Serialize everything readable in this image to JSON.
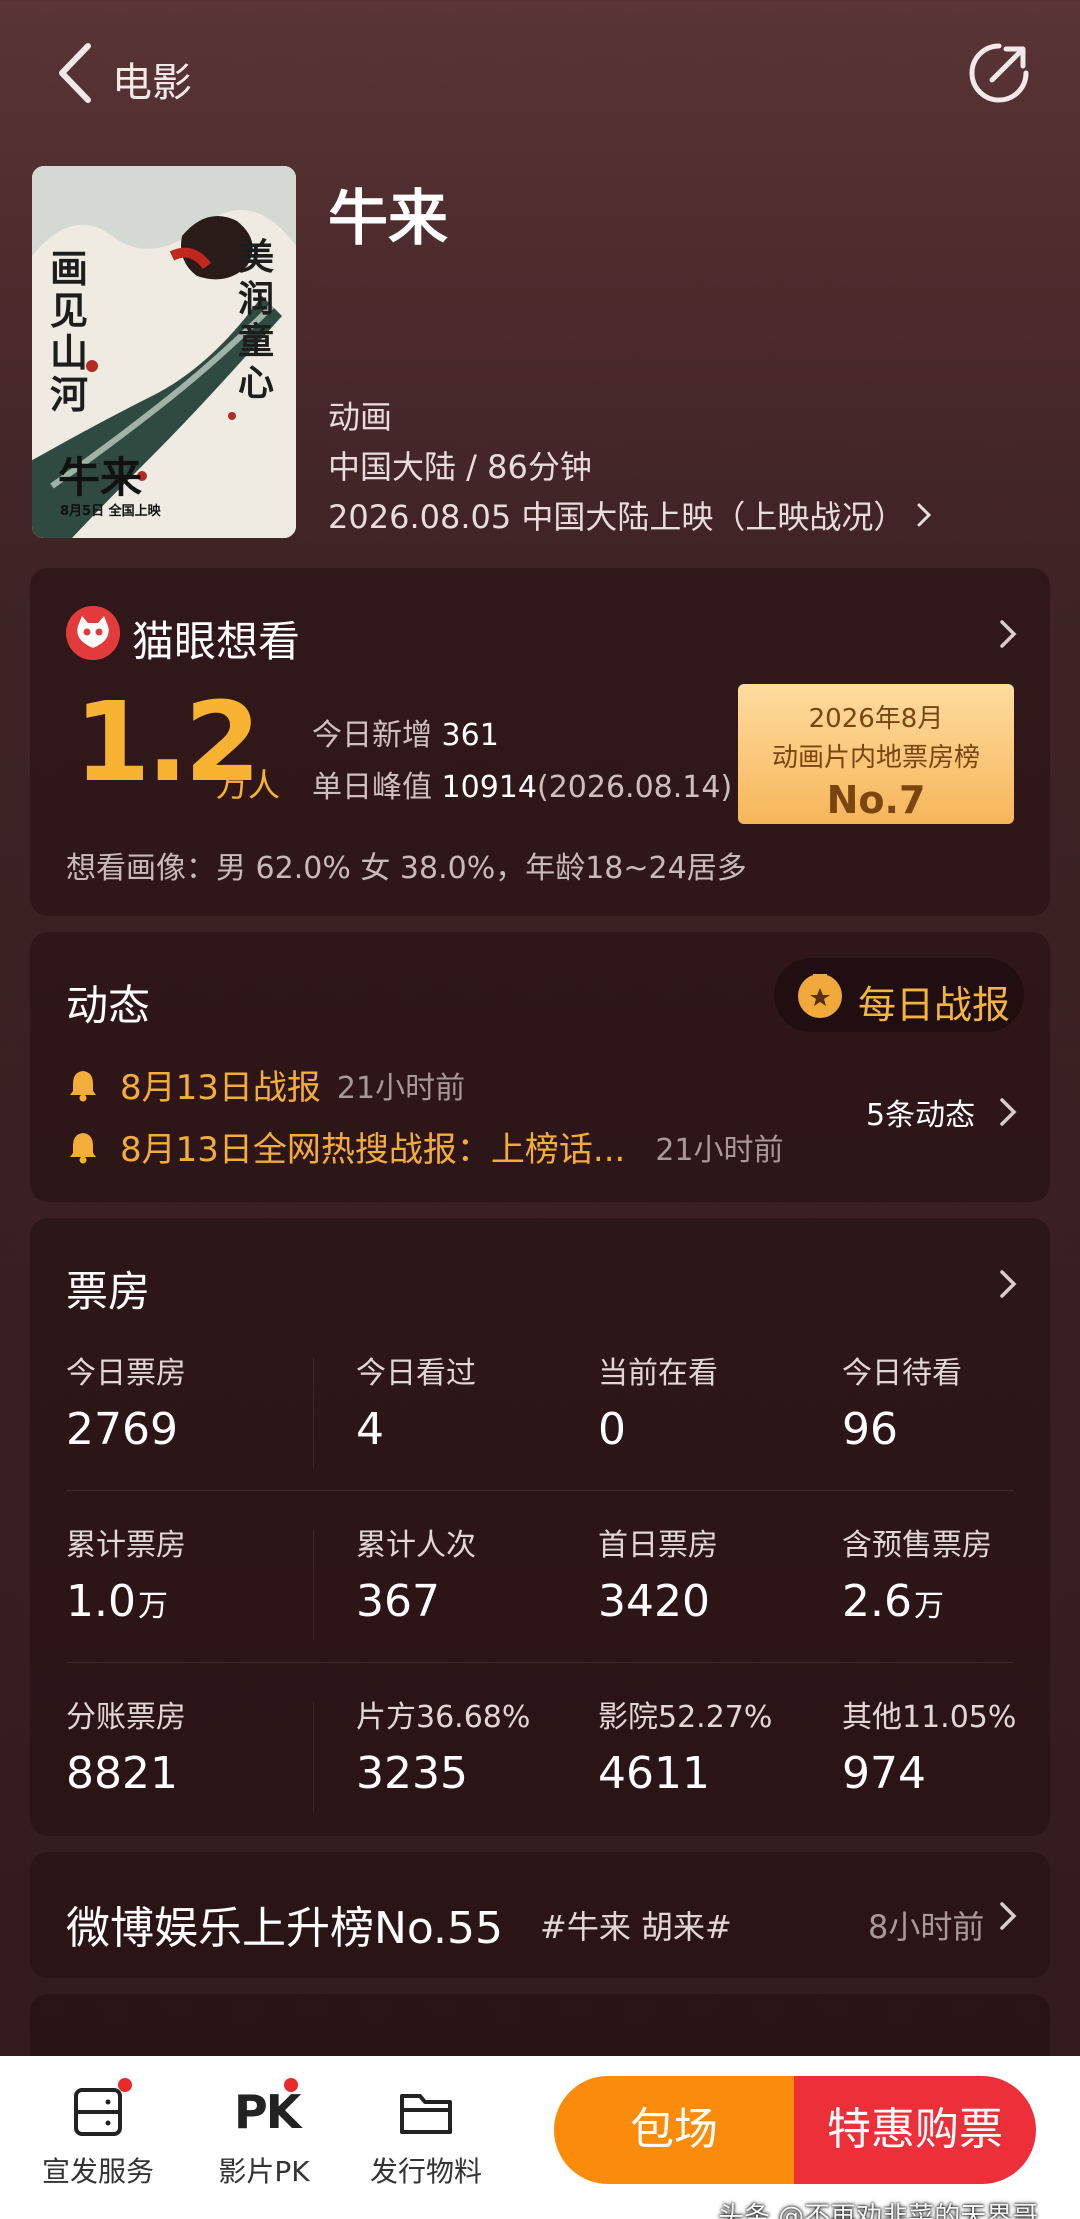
{
  "header": {
    "back_label": "电影",
    "icons": {
      "back": "chevron-left-icon",
      "share": "share-icon"
    }
  },
  "movie": {
    "title": "牛来",
    "genre": "动画",
    "region_duration": "中国大陆 / 86分钟",
    "release": "2026.08.05 中国大陆上映（上映战况）",
    "poster": {
      "left_vertical": "画见山河",
      "right_vertical": "美润童心",
      "name": "牛来",
      "date_line": "8月5日  全国上映"
    }
  },
  "want": {
    "title": "猫眼想看",
    "count": "1.2",
    "unit": "万人",
    "today_label": "今日新增",
    "today_value": "361",
    "peak_label": "单日峰值",
    "peak_value": "10914",
    "peak_date": "(2026.08.14)",
    "rank_line1": "2026年8月",
    "rank_line2": "动画片内地票房榜",
    "rank_no": "No.7",
    "portrait": "想看画像：男 62.0%  女 38.0%，年龄18~24居多"
  },
  "news": {
    "title": "动态",
    "daily_report": "每日战报",
    "items": [
      {
        "title": "8月13日战报",
        "time": "21小时前"
      },
      {
        "title": "8月13日全网热搜战报：上榜话...",
        "time": "21小时前"
      }
    ],
    "more": "5条动态"
  },
  "box_office": {
    "title": "票房",
    "rows": [
      [
        {
          "label": "今日票房",
          "value": "2769",
          "unit": ""
        },
        {
          "label": "今日看过",
          "value": "4",
          "unit": ""
        },
        {
          "label": "当前在看",
          "value": "0",
          "unit": ""
        },
        {
          "label": "今日待看",
          "value": "96",
          "unit": ""
        }
      ],
      [
        {
          "label": "累计票房",
          "value": "1.0",
          "unit": "万"
        },
        {
          "label": "累计人次",
          "value": "367",
          "unit": ""
        },
        {
          "label": "首日票房",
          "value": "3420",
          "unit": ""
        },
        {
          "label": "含预售票房",
          "value": "2.6",
          "unit": "万"
        }
      ],
      [
        {
          "label": "分账票房",
          "value": "8821",
          "unit": ""
        },
        {
          "label": "片方36.68%",
          "value": "3235",
          "unit": ""
        },
        {
          "label": "影院52.27%",
          "value": "4611",
          "unit": ""
        },
        {
          "label": "其他11.05%",
          "value": "974",
          "unit": ""
        }
      ]
    ]
  },
  "weibo": {
    "text": "微博娱乐上升榜No.55",
    "tag": "#牛来 胡来#",
    "time": "8小时前"
  },
  "bottom_bar": {
    "tabs": [
      {
        "label": "宣发服务",
        "icon": "service-icon"
      },
      {
        "label": "影片PK",
        "icon": "pk-icon"
      },
      {
        "label": "发行物料",
        "icon": "folder-icon"
      }
    ],
    "pk_glyph": "PK",
    "booking": "包场",
    "buy": "特惠购票"
  },
  "watermark": "头条 @不再劝韭菜的天界哥",
  "colors": {
    "accent": "#f7b331",
    "buy": "#ed2f39",
    "booking": "#fb8c0b"
  }
}
